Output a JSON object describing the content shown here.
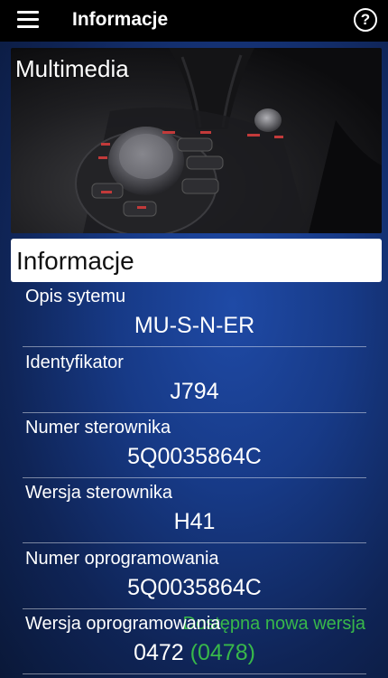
{
  "topbar": {
    "title": "Informacje",
    "help": "?"
  },
  "banner": {
    "label": "Multimedia"
  },
  "section": {
    "title": "Informacje"
  },
  "rows": [
    {
      "label": "Opis sytemu",
      "value": "MU-S-N-ER"
    },
    {
      "label": "Identyfikator",
      "value": "J794"
    },
    {
      "label": "Numer sterownika",
      "value": "5Q0035864C"
    },
    {
      "label": "Wersja sterownika",
      "value": "H41"
    },
    {
      "label": "Numer oprogramowania",
      "value": "5Q0035864C"
    },
    {
      "label": "Wersja oprogramowania",
      "value": "0472",
      "note": "Dostępna nowa wersja",
      "new_value": "(0478)"
    }
  ],
  "colors": {
    "accent_green": "#38b84a",
    "topbar": "#000000"
  }
}
